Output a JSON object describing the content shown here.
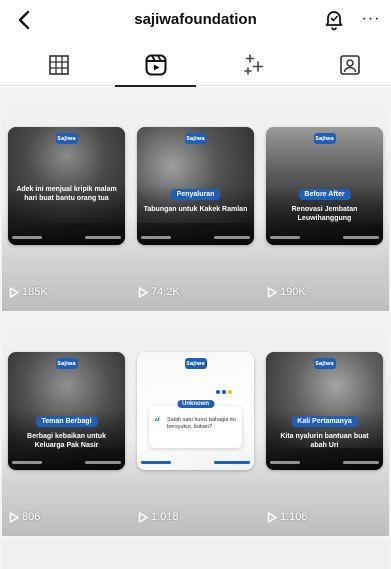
{
  "header": {
    "username": "sajiwafoundation",
    "back_icon": "chevron-left-icon",
    "bell_icon": "bell-icon",
    "more_label": "···"
  },
  "tabs": [
    {
      "name": "grid",
      "icon": "grid-icon",
      "active": false
    },
    {
      "name": "reels",
      "icon": "reels-icon",
      "active": true
    },
    {
      "name": "collab",
      "icon": "sparkles-icon",
      "active": false
    },
    {
      "name": "tagged",
      "icon": "tagged-person-icon",
      "active": false
    }
  ],
  "reels": [
    {
      "caption": "Adek ini menjual kripik malam hari buat bantu orang tua",
      "tag": "",
      "views": "185K"
    },
    {
      "caption": "Tabungan untuk Kakek Ramlan",
      "tag": "Penyaluran",
      "views": "74,2K"
    },
    {
      "caption": "Renovasi Jembatan Leuwihanggung",
      "tag": "Before After",
      "views": "190K"
    },
    {
      "caption": "Berbagi kebaikan untuk Keluarga Pak Nasir",
      "tag": "Teman Berbagi",
      "views": "806"
    },
    {
      "caption": "Salah satu kunci bahagia itu bersyukur, bukan?",
      "tag": "Unknown",
      "views": "1.018"
    },
    {
      "caption": "Kita nyalurin bantuan buat abah Uri",
      "tag": "Kali Pertamanya",
      "views": "1.106"
    }
  ],
  "brand": {
    "logo_text": "Sajiwa",
    "accent_color": "#1f5fb8"
  }
}
